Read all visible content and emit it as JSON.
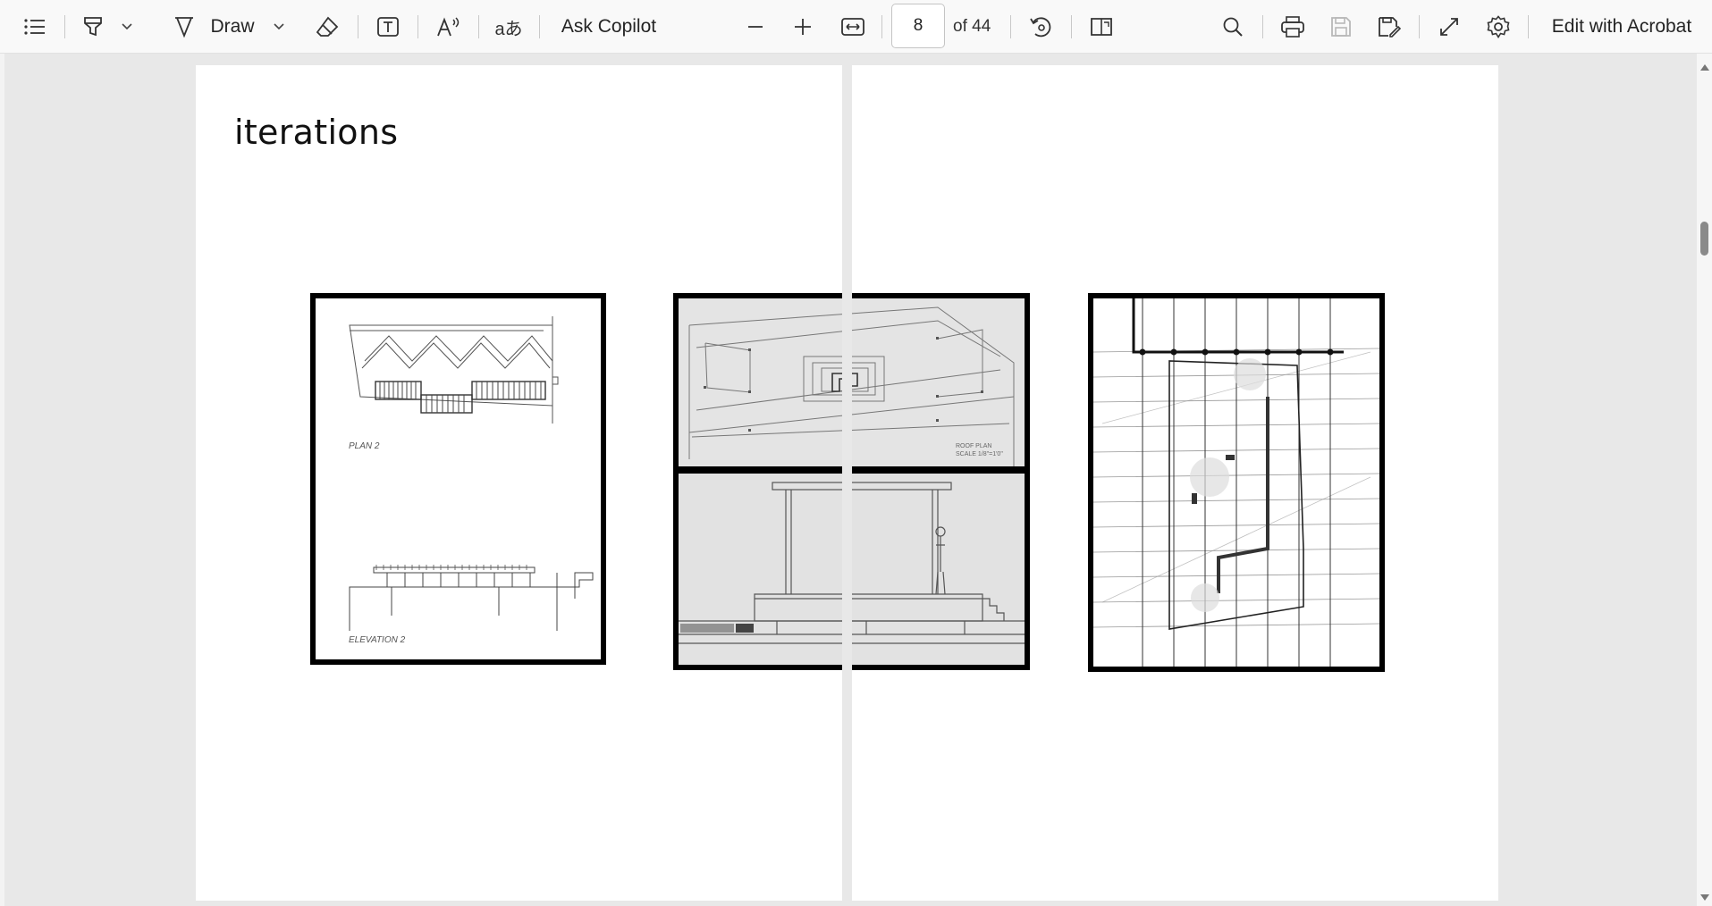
{
  "toolbar": {
    "draw_label": "Draw",
    "ask_copilot_label": "Ask Copilot",
    "current_page": "8",
    "page_total_label": "of 44",
    "edit_acrobat_label": "Edit with Acrobat",
    "icons": [
      "contents-icon",
      "highlight-icon",
      "chevron-down-icon",
      "draw-icon",
      "chevron-down-icon",
      "eraser-icon",
      "add-text-icon",
      "read-aloud-icon",
      "translate-icon",
      "zoom-out-icon",
      "zoom-in-icon",
      "fit-width-icon",
      "rotate-icon",
      "page-view-icon",
      "search-icon",
      "print-icon",
      "save-icon",
      "save-as-icon",
      "fullscreen-icon",
      "settings-icon"
    ]
  },
  "document": {
    "page_title": "iterations",
    "figures": [
      {
        "name": "plan-elevation-sketch",
        "labels": [
          "PLAN 2",
          "ELEVATION 2"
        ]
      },
      {
        "name": "roof-plan-sketch",
        "labels": [
          "ROOF PLAN",
          "SCALE 1/8\"=1'0\""
        ]
      },
      {
        "name": "section-sketch"
      },
      {
        "name": "grid-plan-sketch"
      }
    ]
  }
}
